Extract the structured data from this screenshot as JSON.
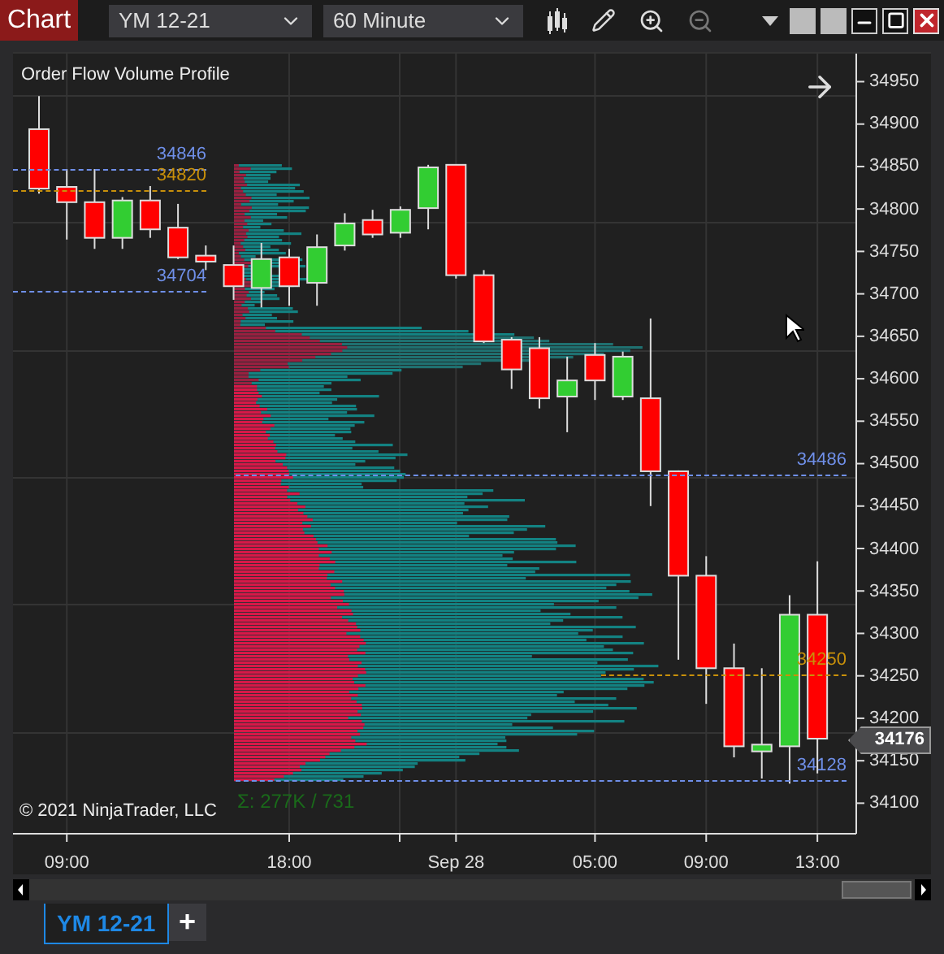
{
  "window": {
    "title": "Chart"
  },
  "toolbar": {
    "instrument": "YM 12-21",
    "interval": "60 Minute"
  },
  "chart": {
    "indicator_label": "Order Flow Volume Profile",
    "levels": [
      {
        "label": "34846",
        "color": "#6f8fe8"
      },
      {
        "label": "34820",
        "color": "#c8900a"
      },
      {
        "label": "34704",
        "color": "#6f8fe8"
      },
      {
        "label": "34486",
        "color": "#6f8fe8"
      },
      {
        "label": "34250",
        "color": "#c8900a"
      },
      {
        "label": "34128",
        "color": "#6f8fe8"
      }
    ],
    "current_price": "34176",
    "profile_total": "Σ: 277K / 731",
    "copyright": "© 2021 NinjaTrader, LLC",
    "chart_data": {
      "type": "candlestick",
      "grid": true,
      "ylim": [
        34064,
        34983
      ],
      "categories": [
        null,
        "09:00",
        null,
        null,
        null,
        null,
        null,
        null,
        null,
        "18:00",
        null,
        null,
        null,
        null,
        null,
        "Sep 28",
        null,
        null,
        null,
        null,
        "05:00",
        null,
        null,
        null,
        "09:00",
        null,
        null,
        null,
        "13:00"
      ],
      "ohlc": [
        [
          34894,
          34933,
          34818,
          34824
        ],
        [
          34826,
          34847,
          34764,
          34808
        ],
        [
          34808,
          34847,
          34753,
          34766
        ],
        [
          34766,
          34814,
          34753,
          34810
        ],
        [
          34810,
          34827,
          34766,
          34776
        ],
        [
          34778,
          34806,
          34741,
          34743
        ],
        [
          34745,
          34757,
          34728,
          34738
        ],
        [
          34734,
          34757,
          34693,
          34709
        ],
        [
          34707,
          34760,
          34684,
          34741
        ],
        [
          34743,
          34753,
          34686,
          34709
        ],
        [
          34713,
          34770,
          34686,
          34755
        ],
        [
          34757,
          34795,
          34751,
          34783
        ],
        [
          34787,
          34799,
          34766,
          34770
        ],
        [
          34772,
          34803,
          34766,
          34799
        ],
        [
          34801,
          34852,
          34776,
          34849
        ],
        [
          34852,
          34852,
          34718,
          34722
        ],
        [
          34722,
          34728,
          34642,
          34644
        ],
        [
          34646,
          34649,
          34588,
          34611
        ],
        [
          34636,
          34649,
          34565,
          34577
        ],
        [
          34579,
          34626,
          34537,
          34598
        ],
        [
          34628,
          34642,
          34575,
          34598
        ],
        [
          34579,
          34632,
          34575,
          34626
        ],
        [
          34577,
          34671,
          34450,
          34491
        ],
        [
          34491,
          34492,
          34269,
          34368
        ],
        [
          34368,
          34391,
          34217,
          34259
        ],
        [
          34259,
          34288,
          34154,
          34167
        ],
        [
          34161,
          34259,
          34129,
          34169
        ],
        [
          34167,
          34345,
          34123,
          34322
        ],
        [
          34322,
          34385,
          34135,
          34176
        ]
      ],
      "yticks": [
        34950,
        34900,
        34850,
        34800,
        34750,
        34700,
        34650,
        34600,
        34550,
        34500,
        34450,
        34400,
        34350,
        34300,
        34250,
        34200,
        34150,
        34100
      ]
    }
  },
  "tabs": [
    {
      "label": "YM 12-21",
      "selected": true
    }
  ],
  "add_tab": "+"
}
